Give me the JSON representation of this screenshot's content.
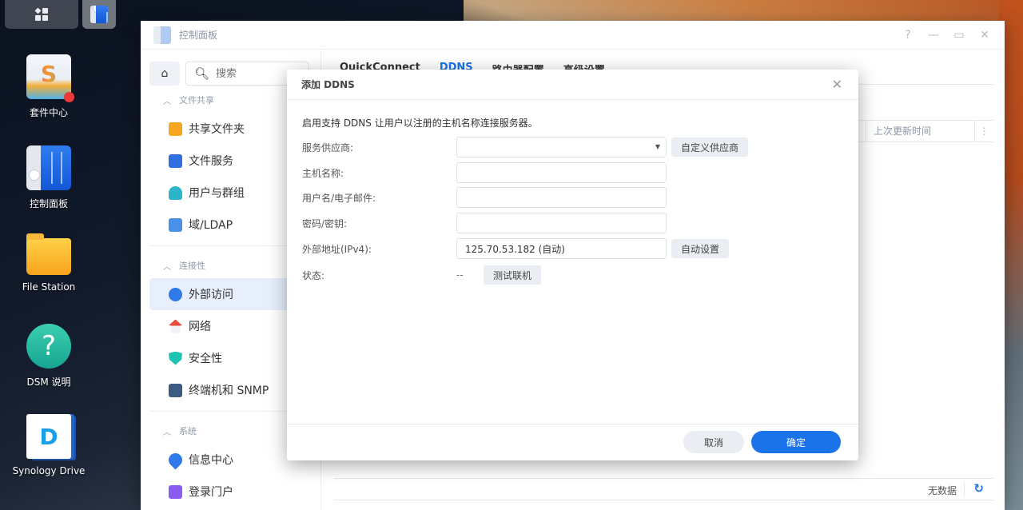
{
  "desktop": {
    "taskbar": {
      "main_menu_icon": "grid-icon",
      "active_app_icon": "control-panel-icon"
    },
    "icons": [
      {
        "label": "套件中心",
        "icon": "package-center-icon",
        "has_badge": true
      },
      {
        "label": "控制面板",
        "icon": "control-panel-icon"
      },
      {
        "label": "File Station",
        "icon": "folder-icon"
      },
      {
        "label": "DSM 说明",
        "icon": "help-icon"
      },
      {
        "label": "Synology Drive",
        "icon": "synology-drive-icon"
      }
    ]
  },
  "window": {
    "title": "控制面板",
    "controls": {
      "help": "?",
      "minimize": "—",
      "maximize": "▭",
      "close": "✕"
    },
    "search": {
      "placeholder": "搜索"
    },
    "sidebar": {
      "sections": [
        {
          "title": "文件共享",
          "items": [
            {
              "label": "共享文件夹"
            },
            {
              "label": "文件服务"
            },
            {
              "label": "用户与群组"
            },
            {
              "label": "域/LDAP"
            }
          ]
        },
        {
          "title": "连接性",
          "items": [
            {
              "label": "外部访问",
              "active": true
            },
            {
              "label": "网络"
            },
            {
              "label": "安全性"
            },
            {
              "label": "终端机和 SNMP"
            }
          ]
        },
        {
          "title": "系统",
          "items": [
            {
              "label": "信息中心"
            },
            {
              "label": "登录门户"
            }
          ]
        }
      ]
    },
    "main": {
      "tabs": [
        {
          "label": "QuickConnect"
        },
        {
          "label": "DDNS",
          "active": true
        },
        {
          "label": "路由器配置"
        },
        {
          "label": "高级设置"
        }
      ],
      "grid": {
        "columns": [
          "上次更新时间"
        ],
        "empty_text": "无数据"
      }
    }
  },
  "modal": {
    "title": "添加 DDNS",
    "description": "启用支持 DDNS 让用户以注册的主机名称连接服务器。",
    "fields": {
      "provider": {
        "label": "服务供应商:",
        "value": "",
        "button": "自定义供应商"
      },
      "hostname": {
        "label": "主机名称:",
        "value": ""
      },
      "username": {
        "label": "用户名/电子邮件:",
        "value": ""
      },
      "password": {
        "label": "密码/密钥:",
        "value": ""
      },
      "external_ip": {
        "label": "外部地址(IPv4):",
        "value": "125.70.53.182 (自动)",
        "button": "自动设置"
      },
      "status": {
        "label": "状态:",
        "value": "--",
        "button": "测试联机"
      }
    },
    "buttons": {
      "cancel": "取消",
      "ok": "确定"
    }
  },
  "colors": {
    "accent": "#1a73e8",
    "active_sidebar_bg": "#e6effb",
    "badge": "#ec3a3a"
  }
}
